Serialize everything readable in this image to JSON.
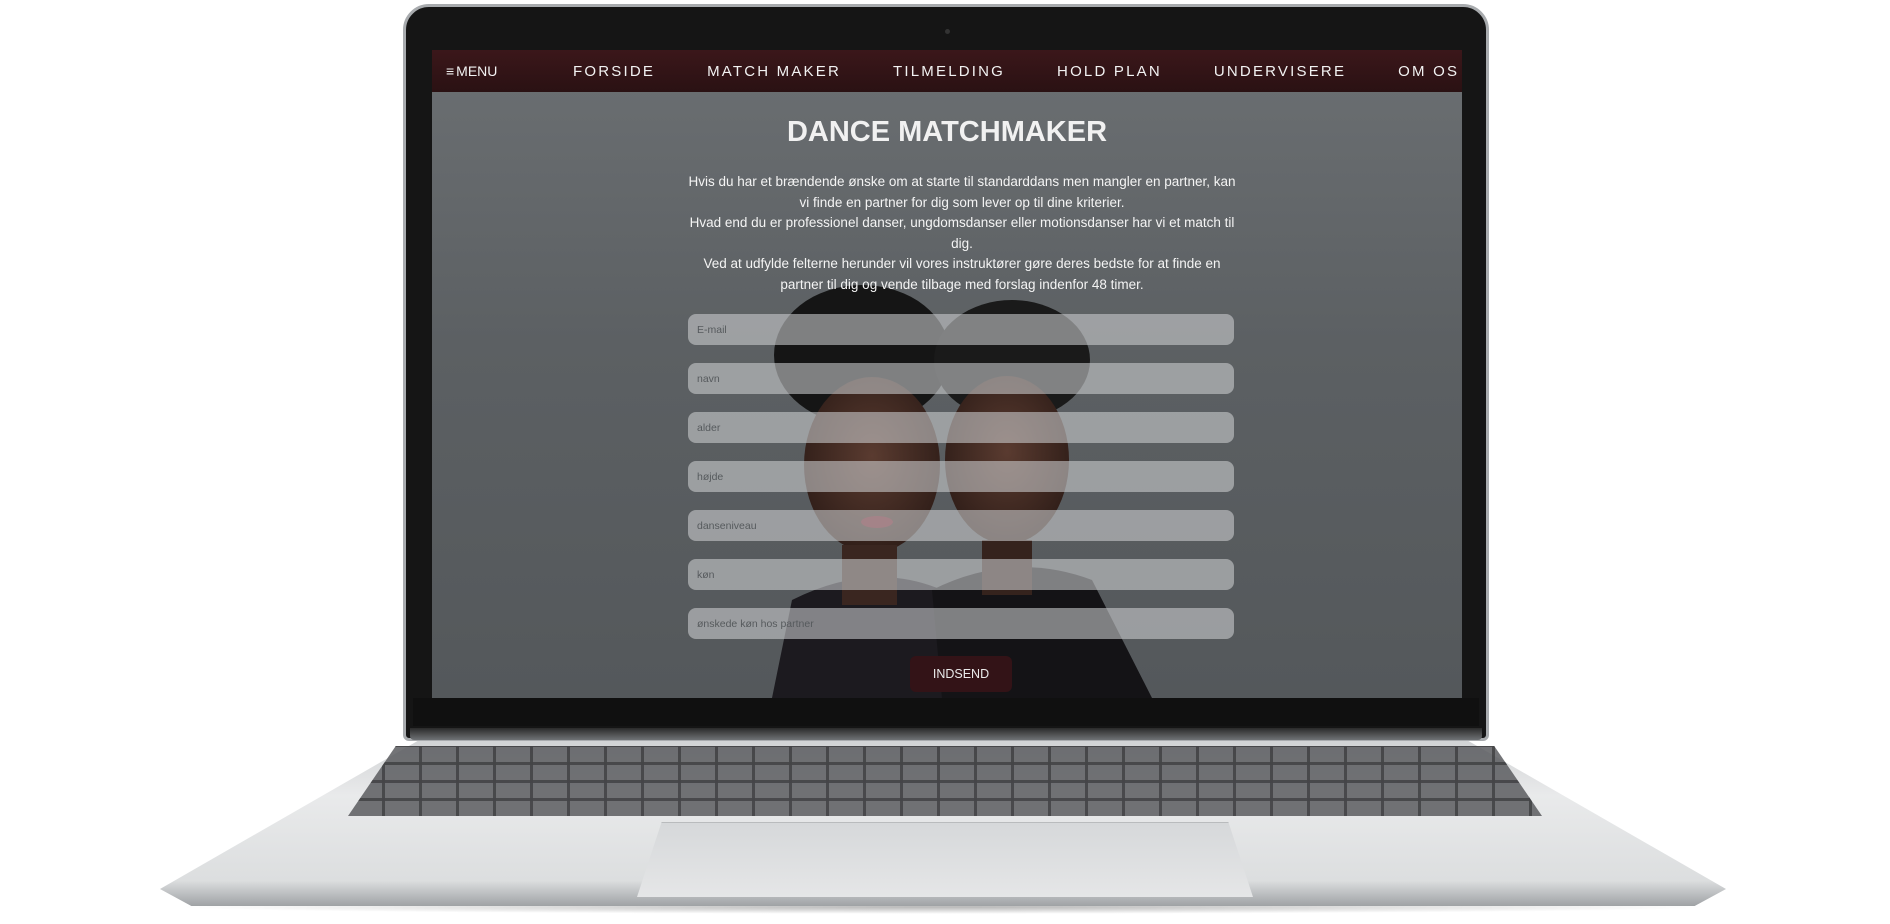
{
  "nav": {
    "menu_label": "MENU",
    "links": [
      "FORSIDE",
      "MATCH MAKER",
      "TILMELDING",
      "HOLD PLAN",
      "UNDERVISERE",
      "OM OS"
    ]
  },
  "hero": {
    "title": "DANCE MATCHMAKER",
    "paragraph1": "Hvis du har et brændende ønske om at starte til standarddans men mangler en partner, kan vi finde en partner for dig som lever op til dine kriterier.",
    "paragraph2": "Hvad end du er professionel danser, ungdomsdanser eller motionsdanser har vi et match til dig.",
    "paragraph3": "Ved at udfylde felterne herunder vil vores instruktører gøre deres bedste for at finde en partner til dig og vende tilbage med forslag indenfor 48 timer."
  },
  "form": {
    "fields": [
      {
        "placeholder": "E-mail",
        "value": ""
      },
      {
        "placeholder": "navn",
        "value": ""
      },
      {
        "placeholder": "alder",
        "value": ""
      },
      {
        "placeholder": "højde",
        "value": ""
      },
      {
        "placeholder": "danseniveau",
        "value": ""
      },
      {
        "placeholder": "køn",
        "value": ""
      },
      {
        "placeholder": "ønskede køn hos partner",
        "value": ""
      }
    ],
    "submit_label": "INDSEND"
  },
  "colors": {
    "navbar": "#2f1316",
    "button": "#331317",
    "screen_bg": "#606467"
  },
  "icons": {
    "menu": "hamburger-icon"
  }
}
